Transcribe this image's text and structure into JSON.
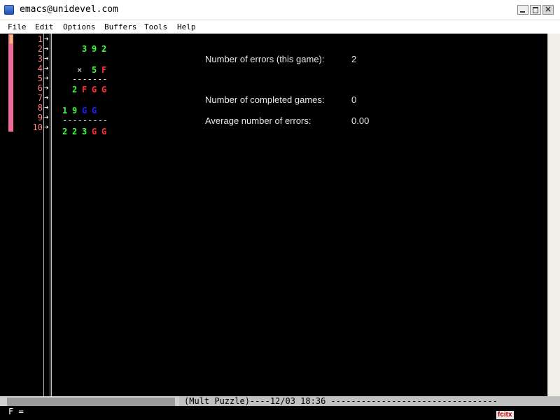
{
  "window": {
    "title": "emacs@unidevel.com",
    "close_glyph": "×"
  },
  "menubar": {
    "items": [
      "File",
      "Edit",
      "Options",
      "Buffers",
      "Tools",
      "Help"
    ]
  },
  "gutter": {
    "line_numbers": [
      "1",
      "2",
      "3",
      "4",
      "5",
      "6",
      "7",
      "8",
      "9",
      "10"
    ],
    "arrow_glyph": "➔"
  },
  "puzzle": {
    "row2": [
      "3",
      "9",
      "2"
    ],
    "row4_op": "×",
    "row4": [
      "5",
      "F"
    ],
    "row5_rule": "-------",
    "row6": [
      "2",
      "F",
      "G",
      "G"
    ],
    "row8": [
      "1",
      "9",
      "G",
      "G"
    ],
    "row9_rule": "---------",
    "row10": [
      "2",
      "2",
      "3",
      "G",
      "G"
    ]
  },
  "stats": {
    "errors_label": "Number of errors (this game):",
    "errors_value": "2",
    "completed_label": "Number of completed games:",
    "completed_value": "0",
    "average_label": "Average number of errors:",
    "average_value": "0.00"
  },
  "modeline": {
    "text": "(Mult Puzzle)----12/03 18:36 ---------------------------------"
  },
  "minibuffer": {
    "prompt": "F = "
  },
  "ime": {
    "label": "fcitx"
  },
  "colors": {
    "fringe": "#f06b9d",
    "line_number": "#ff8080",
    "digit_green": "#3dff3d",
    "letter_red": "#ff3030",
    "letter_blue": "#2020ff"
  }
}
